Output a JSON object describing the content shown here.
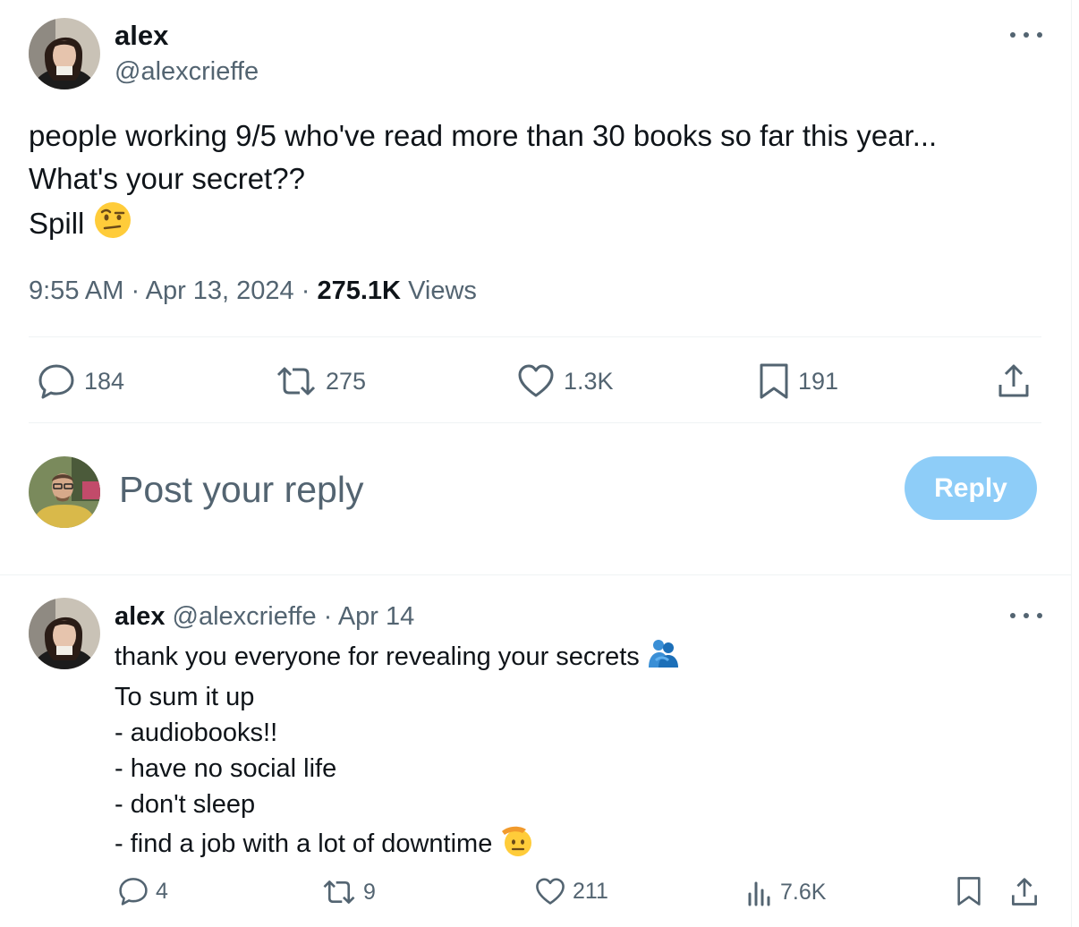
{
  "tweet": {
    "author_name": "alex",
    "author_handle": "@alexcrieffe",
    "text_lines": [
      "people working 9/5 who've read more than 30 books so far this year...",
      "What's your secret??",
      "Spill"
    ],
    "time": "9:55 AM",
    "date": "Apr 13, 2024",
    "views_count": "275.1K",
    "views_label": "Views",
    "separator": "·",
    "emoji_icon": "face-with-raised-eyebrow",
    "actions": {
      "replies": "184",
      "reposts": "275",
      "likes": "1.3K",
      "bookmarks": "191"
    }
  },
  "reply_box": {
    "placeholder": "Post your reply",
    "button_label": "Reply"
  },
  "reply_tweet": {
    "author_name": "alex",
    "author_handle": "@alexcrieffe",
    "date": "Apr 14",
    "separator": "·",
    "text_lines": [
      "thank you everyone for revealing your secrets",
      "To sum it up",
      "- audiobooks!!",
      "- have no social life",
      "- don't sleep",
      "- find a job with a lot of downtime"
    ],
    "emoji_icons": [
      "people-hugging",
      "saluting-face"
    ],
    "actions": {
      "replies": "4",
      "reposts": "9",
      "likes": "211",
      "views": "7.6K"
    }
  },
  "colors": {
    "text_primary": "#0f1419",
    "text_secondary": "#536471",
    "divider": "#eff3f4",
    "reply_button_disabled": "#8ecdf8"
  }
}
